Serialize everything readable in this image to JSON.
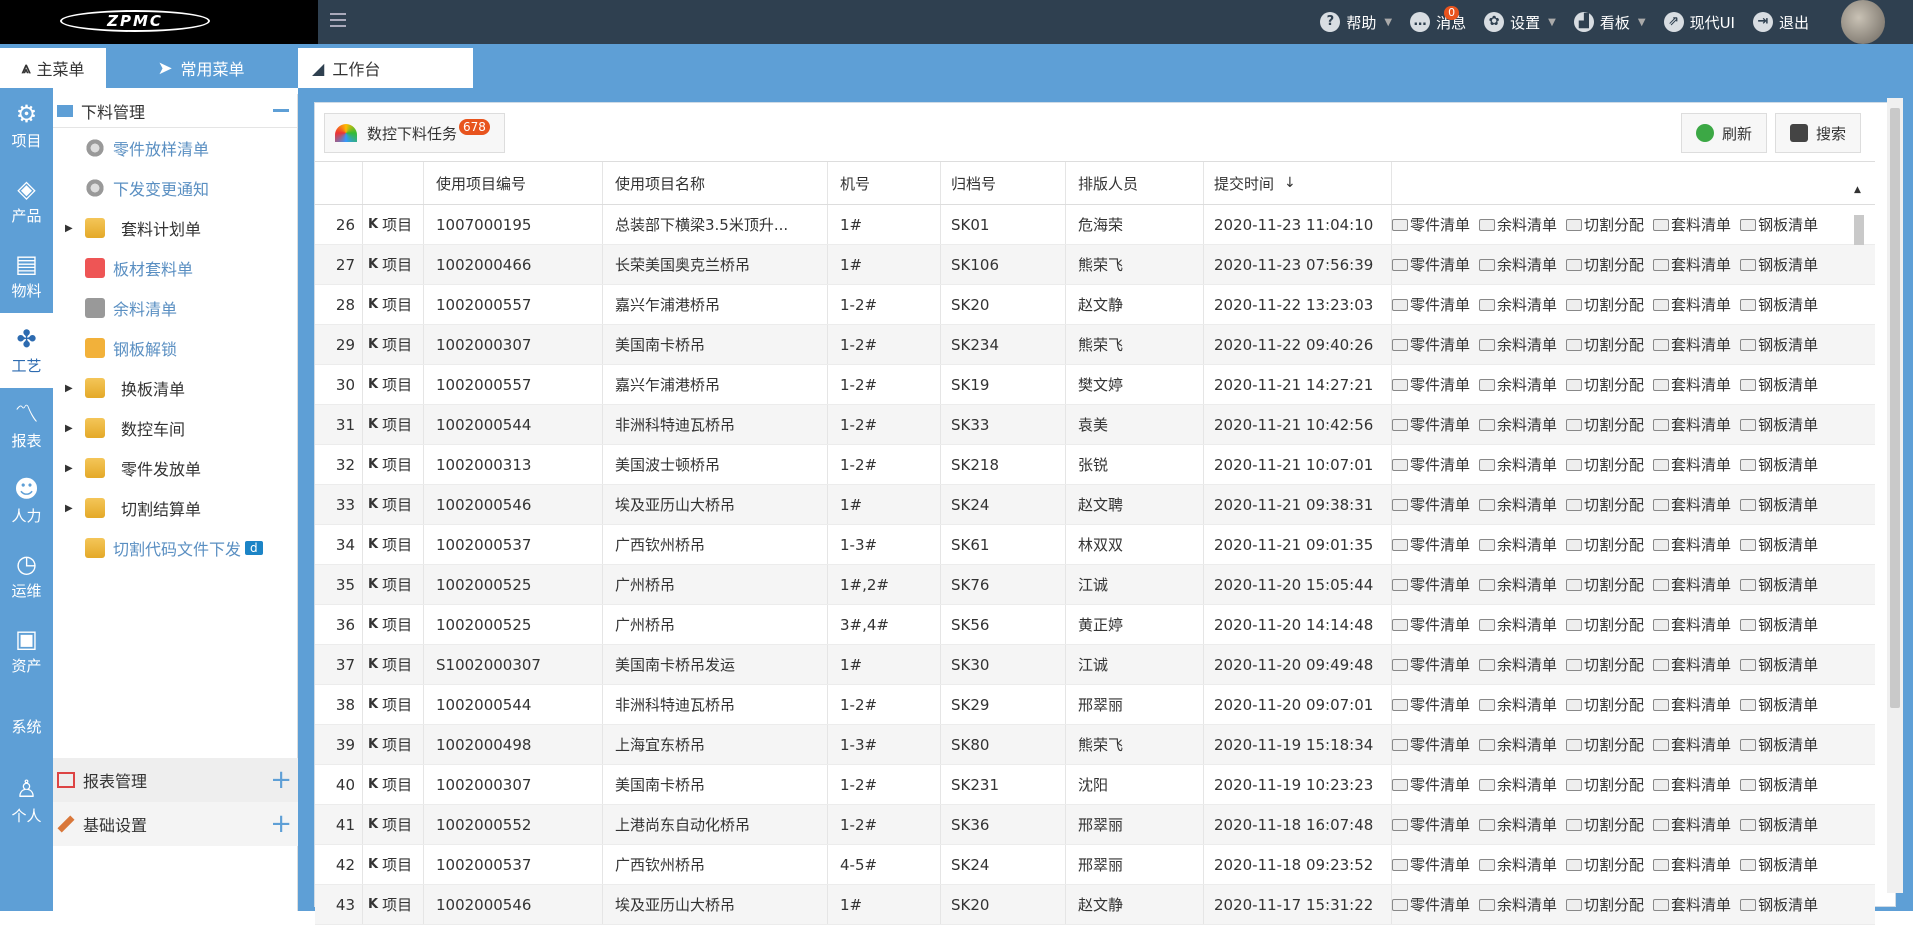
{
  "topbar": {
    "logo_text": "ZPMC",
    "nav": [
      {
        "label": "帮助",
        "icon": "question-icon",
        "caret": true
      },
      {
        "label": "消息",
        "icon": "message-icon",
        "badge": "0",
        "caret": false
      },
      {
        "label": "设置",
        "icon": "gear-icon",
        "caret": true
      },
      {
        "label": "看板",
        "icon": "bar-chart-icon",
        "caret": true
      },
      {
        "label": "现代UI",
        "icon": "share-icon",
        "caret": false
      },
      {
        "label": "退出",
        "icon": "logout-icon",
        "caret": false
      }
    ]
  },
  "tabs": {
    "main_menu": "主菜单",
    "common_menu": "常用菜单",
    "workbench": "工作台"
  },
  "rail": [
    {
      "label": "项目",
      "icon": "project-icon",
      "glyph": "⚙"
    },
    {
      "label": "产品",
      "icon": "cube-icon",
      "glyph": "◈"
    },
    {
      "label": "物料",
      "icon": "cart-icon",
      "glyph": "▤"
    },
    {
      "label": "工艺",
      "icon": "puzzle-icon",
      "glyph": "✤",
      "active": true
    },
    {
      "label": "报表",
      "icon": "chart-icon",
      "glyph": "〽"
    },
    {
      "label": "人力",
      "icon": "users-icon",
      "glyph": "☻"
    },
    {
      "label": "运维",
      "icon": "clock-icon",
      "glyph": "◷"
    },
    {
      "label": "资产",
      "icon": "briefcase-icon",
      "glyph": "▣"
    },
    {
      "label": "系统",
      "icon": "code-icon",
      "glyph": "</>"
    },
    {
      "label": "个人",
      "icon": "person-icon",
      "glyph": "♙"
    }
  ],
  "menu": {
    "section_title": "下料管理",
    "items": [
      {
        "label": "零件放样清单",
        "icon": "gear-icon",
        "kind": "cog",
        "folder": false
      },
      {
        "label": "下发变更通知",
        "icon": "gear-icon",
        "kind": "cog",
        "folder": false
      },
      {
        "label": "套料计划单",
        "icon": "folder-icon",
        "kind": "fold",
        "folder": true
      },
      {
        "label": "板材套料单",
        "icon": "document-icon",
        "kind": "doc",
        "folder": false
      },
      {
        "label": "余料清单",
        "icon": "puzzle-piece-icon",
        "kind": "puzzle",
        "folder": false
      },
      {
        "label": "钢板解锁",
        "icon": "lock-icon",
        "kind": "lock",
        "folder": false
      },
      {
        "label": "换板清单",
        "icon": "folder-icon",
        "kind": "fold",
        "folder": true
      },
      {
        "label": "数控车间",
        "icon": "folder-icon",
        "kind": "fold",
        "folder": true
      },
      {
        "label": "零件发放单",
        "icon": "folder-icon",
        "kind": "fold",
        "folder": true
      },
      {
        "label": "切割结算单",
        "icon": "folder-icon",
        "kind": "fold",
        "folder": true
      },
      {
        "label": "切割代码文件下发",
        "icon": "folder-icon",
        "kind": "fold",
        "folder": false,
        "tag": "d"
      }
    ],
    "footer": [
      {
        "label": "报表管理",
        "icon": "report-icon"
      },
      {
        "label": "基础设置",
        "icon": "wrench-icon"
      }
    ]
  },
  "toolbar": {
    "task_label": "数控下料任务",
    "task_count": "678",
    "refresh": "刷新",
    "search": "搜索"
  },
  "table": {
    "headers": [
      "",
      "",
      "使用项目编号",
      "使用项目名称",
      "机号",
      "归档号",
      "排版人员",
      "提交时间",
      ""
    ],
    "row_tag": "项目",
    "actions": [
      "零件清单",
      "余料清单",
      "切割分配",
      "套料清单",
      "钢板清单"
    ],
    "rows": [
      [
        "26",
        "1007000195",
        "总装部下横梁3.5米顶升...",
        "1#",
        "SK01",
        "危海荣",
        "2020-11-23 11:04:10"
      ],
      [
        "27",
        "1002000466",
        "长荣美国奥克兰桥吊",
        "1#",
        "SK106",
        "熊荣飞",
        "2020-11-23 07:56:39"
      ],
      [
        "28",
        "1002000557",
        "嘉兴乍浦港桥吊",
        "1-2#",
        "SK20",
        "赵文静",
        "2020-11-22 13:23:03"
      ],
      [
        "29",
        "1002000307",
        "美国南卡桥吊",
        "1-2#",
        "SK234",
        "熊荣飞",
        "2020-11-22 09:40:26"
      ],
      [
        "30",
        "1002000557",
        "嘉兴乍浦港桥吊",
        "1-2#",
        "SK19",
        "樊文婷",
        "2020-11-21 14:27:21"
      ],
      [
        "31",
        "1002000544",
        "非洲科特迪瓦桥吊",
        "1-2#",
        "SK33",
        "袁美",
        "2020-11-21 10:42:56"
      ],
      [
        "32",
        "1002000313",
        "美国波士顿桥吊",
        "1-2#",
        "SK218",
        "张锐",
        "2020-11-21 10:07:01"
      ],
      [
        "33",
        "1002000546",
        "埃及亚历山大桥吊",
        "1#",
        "SK24",
        "赵文聘",
        "2020-11-21 09:38:31"
      ],
      [
        "34",
        "1002000537",
        "广西钦州桥吊",
        "1-3#",
        "SK61",
        "林双双",
        "2020-11-21 09:01:35"
      ],
      [
        "35",
        "1002000525",
        "广州桥吊",
        "1#,2#",
        "SK76",
        "江诚",
        "2020-11-20 15:05:44"
      ],
      [
        "36",
        "1002000525",
        "广州桥吊",
        "3#,4#",
        "SK56",
        "黄正婷",
        "2020-11-20 14:14:48"
      ],
      [
        "37",
        "S1002000307",
        "美国南卡桥吊发运",
        "1#",
        "SK30",
        "江诚",
        "2020-11-20 09:49:48"
      ],
      [
        "38",
        "1002000544",
        "非洲科特迪瓦桥吊",
        "1-2#",
        "SK29",
        "邢翠丽",
        "2020-11-20 09:07:01"
      ],
      [
        "39",
        "1002000498",
        "上海宜东桥吊",
        "1-3#",
        "SK80",
        "熊荣飞",
        "2020-11-19 15:18:34"
      ],
      [
        "40",
        "1002000307",
        "美国南卡桥吊",
        "1-2#",
        "SK231",
        "沈阳",
        "2020-11-19 10:23:23"
      ],
      [
        "41",
        "1002000552",
        "上港尚东自动化桥吊",
        "1-2#",
        "SK36",
        "邢翠丽",
        "2020-11-18 16:07:48"
      ],
      [
        "42",
        "1002000537",
        "广西钦州桥吊",
        "4-5#",
        "SK24",
        "邢翠丽",
        "2020-11-18 09:23:52"
      ],
      [
        "43",
        "1002000546",
        "埃及亚历山大桥吊",
        "1#",
        "SK20",
        "赵文静",
        "2020-11-17 15:31:22"
      ]
    ]
  },
  "colors": {
    "topbar": "#2f4050",
    "accent": "#5e9fd6",
    "badge": "#e8541e"
  }
}
